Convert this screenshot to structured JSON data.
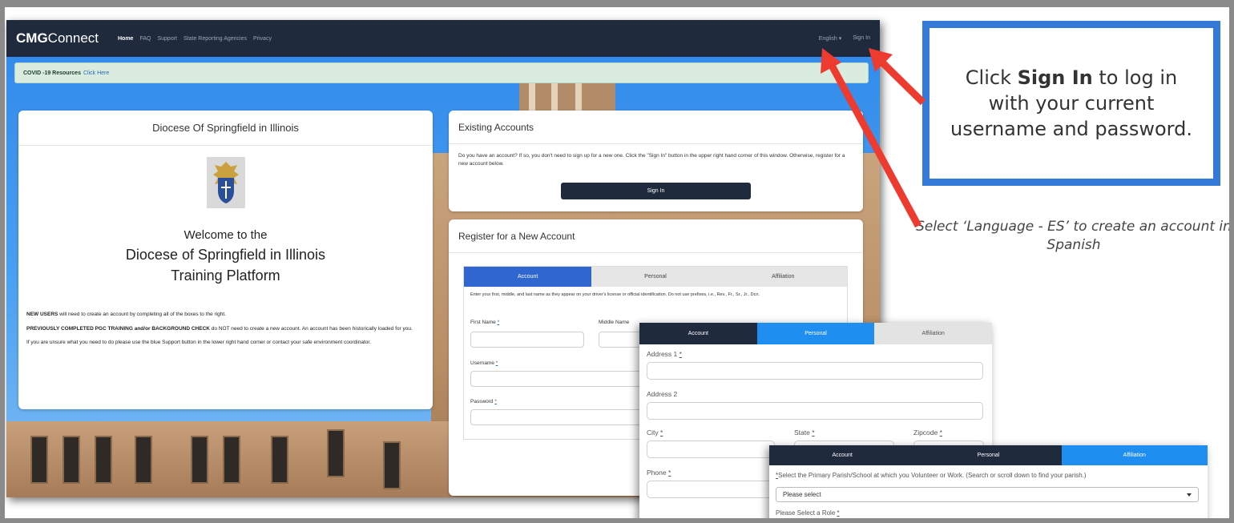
{
  "navbar": {
    "brand_bold": "CMG",
    "brand_rest": "Connect",
    "links": [
      "Home",
      "FAQ",
      "Support",
      "State Reporting Agencies",
      "Privacy"
    ],
    "language": "English",
    "sign_in": "Sign In"
  },
  "banner": {
    "bold": "COVID -19 Resources",
    "link": "Click Here"
  },
  "welcome_card": {
    "header": "Diocese Of Springfield in Illinois",
    "title_line1": "Welcome to the",
    "title_line2": "Diocese of Springfield in Illinois",
    "title_line3": "Training Platform",
    "p1_bold": "NEW USERS",
    "p1_rest": " will need to create an account by completing all of the boxes to the right.",
    "p2_bold": "PREVIOUSLY COMPLETED PGC TRAINING and/or BACKGROUND CHECK",
    "p2_rest": " do NOT need to create a new account.  An account has been historically loaded for you.",
    "p3": "If you are unsure what you need to do please use the blue Support button in the lower right hand corner or contact your safe environment coordinator."
  },
  "existing_card": {
    "header": "Existing Accounts",
    "text": "Do you have an account? If so, you don't need to sign up for a new one. Click the \"Sign In\" button in the upper right hand corner of this window. Otherwise, register for a new account below.",
    "button": "Sign In"
  },
  "register_card": {
    "header": "Register for a New Account",
    "tabs": [
      "Account",
      "Personal",
      "Affiliation"
    ],
    "note": "Enter your first, middle, and last name as they appear on your driver's license or official identification. Do not use prefixes, i.e., Rev., Fr., Sr., Jr., Dcn.",
    "first_name": "First Name",
    "middle_name": "Middle Name",
    "username": "Username",
    "password": "Password",
    "req": "*"
  },
  "personal_form": {
    "tabs": [
      "Account",
      "Personal",
      "Affiliation"
    ],
    "address1": "Address 1",
    "address2": "Address 2",
    "city": "City",
    "state": "State",
    "zipcode": "Zipcode",
    "phone": "Phone",
    "req": "*"
  },
  "affiliation_form": {
    "tabs": [
      "Account",
      "Personal",
      "Affiliation"
    ],
    "instruction_req": "*",
    "instruction": "Select the Primary Parish/School at which you Volunteer or Work. (Search or scroll down to find your parish.)",
    "select_value": "Please select",
    "role_label": "Please Select a Role",
    "req": "*"
  },
  "callout": {
    "pre": "Click ",
    "bold": "Sign In",
    "post": " to log in with your current username and password."
  },
  "language_note": "Select ‘Language - ES’ to create an account in Spanish",
  "colors": {
    "navbar": "#1f2a3c",
    "accent_blue": "#3279d8",
    "tab_blue": "#1e8ef0",
    "arrow_red": "#ee3b2f"
  }
}
